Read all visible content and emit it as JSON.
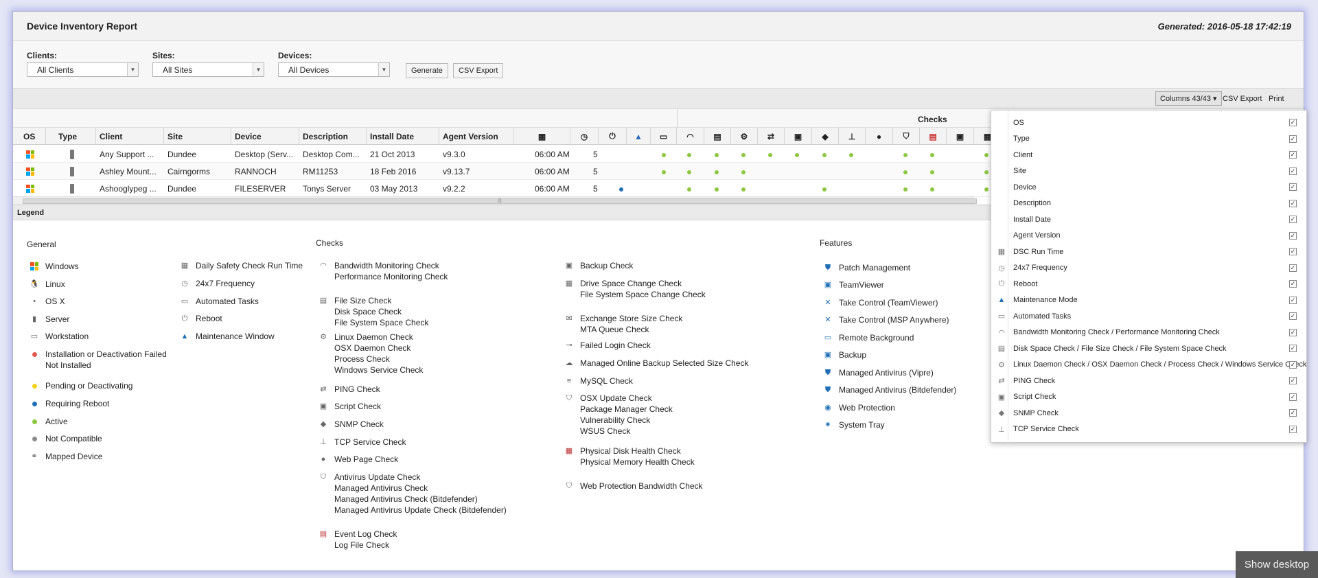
{
  "report": {
    "title": "Device Inventory Report",
    "generated": "Generated: 2016-05-18 17:42:19"
  },
  "filters": {
    "clients_label": "Clients:",
    "clients_value": "All Clients",
    "sites_label": "Sites:",
    "sites_value": "All Sites",
    "devices_label": "Devices:",
    "devices_value": "All Devices",
    "generate_button": "Generate",
    "csv_export_button": "CSV Export"
  },
  "toolbar": {
    "columns_button": "Columns 43/43 ▾",
    "csv_export": "CSV Export",
    "print": "Print"
  },
  "grid": {
    "group_checks": "Checks",
    "headers": {
      "os": "OS",
      "type": "Type",
      "client": "Client",
      "site": "Site",
      "device": "Device",
      "description": "Description",
      "install_date": "Install Date",
      "agent_version": "Agent Version"
    },
    "rows": [
      {
        "client": "Any Support ...",
        "site": "Dundee",
        "device": "Desktop (Serv...",
        "description": "Desktop Com...",
        "install_date": "21 Oct 2013",
        "agent_version": "v9.3.0",
        "dsc_time": "06:00 AM",
        "frequency": "5"
      },
      {
        "client": "Ashley Mount...",
        "site": "Cairngorms",
        "device": "RANNOCH",
        "description": "RM11253",
        "install_date": "18 Feb 2016",
        "agent_version": "v9.13.7",
        "dsc_time": "06:00 AM",
        "frequency": "5"
      },
      {
        "client": "Ashooglypeg ...",
        "site": "Dundee",
        "device": "FILESERVER",
        "description": "Tonys Server",
        "install_date": "03 May 2013",
        "agent_version": "v9.2.2",
        "dsc_time": "06:00 AM",
        "frequency": "5"
      }
    ],
    "colors": {
      "active": "#8dc63f",
      "reboot": "#1f6fb5"
    }
  },
  "legend": {
    "bar_title": "Legend",
    "general_title": "General",
    "checks_title": "Checks",
    "features_title": "Features",
    "general": [
      {
        "icon": "windows-icon",
        "text": "Windows"
      },
      {
        "icon": "linux-icon",
        "text": "Linux"
      },
      {
        "icon": "apple-icon",
        "text": "OS X"
      },
      {
        "icon": "server-icon",
        "text": "Server"
      },
      {
        "icon": "workstation-icon",
        "text": "Workstation"
      },
      {
        "icon": "red-dot-icon",
        "text": "Installation or Deactivation Failed\nNot Installed"
      },
      {
        "icon": "yellow-dot-icon",
        "text": "Pending or Deactivating"
      },
      {
        "icon": "blue-dot-icon",
        "text": "Requiring Reboot"
      },
      {
        "icon": "green-dot-icon",
        "text": "Active"
      },
      {
        "icon": "grey-dot-icon",
        "text": "Not Compatible"
      },
      {
        "icon": "link-icon",
        "text": "Mapped Device"
      }
    ],
    "general2": [
      {
        "icon": "calendar-icon",
        "text": "Daily Safety Check Run Time"
      },
      {
        "icon": "clock-icon",
        "text": "24x7 Frequency"
      },
      {
        "icon": "monitor-icon",
        "text": "Automated Tasks"
      },
      {
        "icon": "power-icon",
        "text": "Reboot"
      },
      {
        "icon": "cone-icon",
        "text": "Maintenance Window"
      }
    ],
    "checks1": [
      {
        "icon": "gauge-icon",
        "text": "Bandwidth Monitoring Check\nPerformance Monitoring Check"
      },
      {
        "icon": "disk-icon",
        "text": "File Size Check\nDisk Space Check\nFile System Space Check"
      },
      {
        "icon": "gears-icon",
        "text": "Linux Daemon Check\nOSX Daemon Check\nProcess Check\nWindows Service Check"
      },
      {
        "icon": "arrows-icon",
        "text": "PING Check"
      },
      {
        "icon": "terminal-icon",
        "text": "Script Check"
      },
      {
        "icon": "cube-icon",
        "text": "SNMP Check"
      },
      {
        "icon": "network-icon",
        "text": "TCP Service Check"
      },
      {
        "icon": "globe-icon",
        "text": "Web Page Check"
      },
      {
        "icon": "shield-icon",
        "text": "Antivirus Update Check\nManaged Antivirus Check\nManaged Antivirus Check (Bitdefender)\nManaged Antivirus Update Check (Bitdefender)"
      },
      {
        "icon": "eventlog-icon",
        "text": "Event Log Check\nLog File Check"
      }
    ],
    "checks2": [
      {
        "icon": "backup-icon",
        "text": "Backup Check"
      },
      {
        "icon": "drive-icon",
        "text": "Drive Space Change Check\nFile System Space Change Check"
      },
      {
        "icon": "mail-icon",
        "text": "Exchange Store Size Check\nMTA Queue Check"
      },
      {
        "icon": "key-icon",
        "text": "Failed Login Check"
      },
      {
        "icon": "cloud-icon",
        "text": "Managed Online Backup Selected Size Check"
      },
      {
        "icon": "database-icon",
        "text": "MySQL Check"
      },
      {
        "icon": "update-shield-icon",
        "text": "OSX Update Check\nPackage Manager Check\nVulnerability Check\nWSUS Check"
      },
      {
        "icon": "hardware-icon",
        "text": "Physical Disk Health Check\nPhysical Memory Health Check"
      },
      {
        "icon": "webprotect-icon",
        "text": "Web Protection Bandwidth Check"
      }
    ],
    "features": [
      {
        "icon": "patch-icon",
        "text": "Patch Management"
      },
      {
        "icon": "teamviewer-icon",
        "text": "TeamViewer"
      },
      {
        "icon": "takecontrol-icon",
        "text": "Take Control (TeamViewer)"
      },
      {
        "icon": "takecontrol-msp-icon",
        "text": "Take Control (MSP Anywhere)"
      },
      {
        "icon": "remote-icon",
        "text": "Remote Background"
      },
      {
        "icon": "backup-feature-icon",
        "text": "Backup"
      },
      {
        "icon": "vipre-icon",
        "text": "Managed Antivirus (Vipre)"
      },
      {
        "icon": "bitdefender-icon",
        "text": "Managed Antivirus (Bitdefender)"
      },
      {
        "icon": "webprotection-icon",
        "text": "Web Protection"
      },
      {
        "icon": "systray-icon",
        "text": "System Tray"
      }
    ]
  },
  "columns_popup": [
    {
      "icon": "",
      "label": "OS"
    },
    {
      "icon": "",
      "label": "Type"
    },
    {
      "icon": "",
      "label": "Client"
    },
    {
      "icon": "",
      "label": "Site"
    },
    {
      "icon": "",
      "label": "Device"
    },
    {
      "icon": "",
      "label": "Description"
    },
    {
      "icon": "",
      "label": "Install Date"
    },
    {
      "icon": "",
      "label": "Agent Version"
    },
    {
      "icon": "calendar-icon",
      "label": "DSC Run Time"
    },
    {
      "icon": "clock-icon",
      "label": "24x7 Frequency"
    },
    {
      "icon": "power-icon",
      "label": "Reboot"
    },
    {
      "icon": "cone-icon",
      "label": "Maintenance Mode"
    },
    {
      "icon": "monitor-icon",
      "label": "Automated Tasks"
    },
    {
      "icon": "gauge-icon",
      "label": "Bandwidth Monitoring Check / Performance Monitoring Check"
    },
    {
      "icon": "disk-icon",
      "label": "Disk Space Check / File Size Check / File System Space Check"
    },
    {
      "icon": "gears-icon",
      "label": "Linux Daemon Check / OSX Daemon Check / Process Check / Windows Service Check"
    },
    {
      "icon": "arrows-icon",
      "label": "PING Check"
    },
    {
      "icon": "terminal-icon",
      "label": "Script Check"
    },
    {
      "icon": "cube-icon",
      "label": "SNMP Check"
    },
    {
      "icon": "network-icon",
      "label": "TCP Service Check"
    }
  ],
  "taskbar": {
    "show_desktop": "Show desktop"
  }
}
